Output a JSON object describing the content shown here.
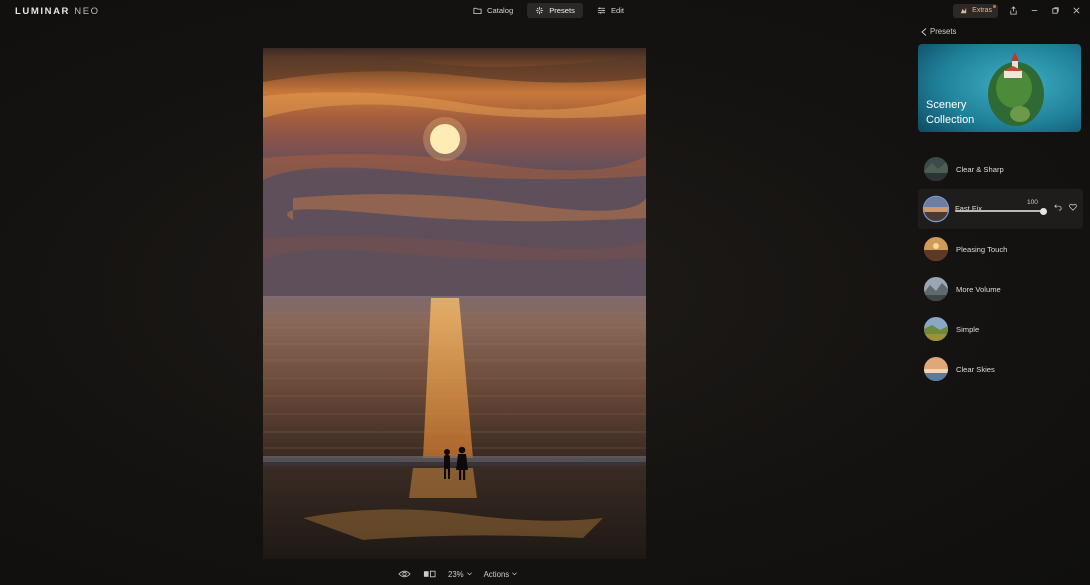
{
  "app": {
    "logo_primary": "LUMINAR",
    "logo_secondary": "NEO"
  },
  "nav": {
    "tabs": [
      {
        "label": "Catalog",
        "icon": "folder-icon",
        "active": false
      },
      {
        "label": "Presets",
        "icon": "sparkle-icon",
        "active": true
      },
      {
        "label": "Edit",
        "icon": "sliders-icon",
        "active": false
      }
    ]
  },
  "window": {
    "extras_label": "Extras",
    "controls": [
      "share-icon",
      "minimize-icon",
      "restore-icon",
      "close-icon"
    ]
  },
  "viewer": {
    "zoom": "23%",
    "actions_label": "Actions"
  },
  "panel": {
    "back_label": "Presets",
    "collection_title_line1": "Scenery",
    "collection_title_line2": "Collection",
    "presets": [
      {
        "label": "Clear & Sharp",
        "active": false
      },
      {
        "label": "Fast Fix",
        "active": true,
        "amount": 100
      },
      {
        "label": "Pleasing Touch",
        "active": false
      },
      {
        "label": "More Volume",
        "active": false
      },
      {
        "label": "Simple",
        "active": false
      },
      {
        "label": "Clear Skies",
        "active": false
      }
    ]
  },
  "colors": {
    "background": "#121110",
    "active_tab": "#2b2927",
    "extras_text": "#e8b38a",
    "accent_ring": "#7ea0d8"
  }
}
